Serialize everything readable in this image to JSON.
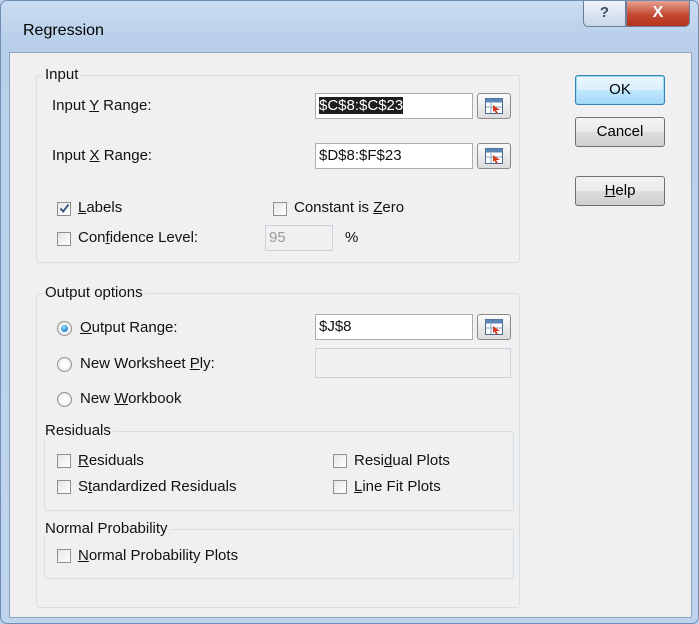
{
  "window": {
    "title": "Regression",
    "help_glyph": "?",
    "close_glyph": "X"
  },
  "input": {
    "group_title": "Input",
    "y_label_pre": "Input ",
    "y_label_u": "Y",
    "y_label_post": " Range:",
    "y_value": "$C$8:$C$23",
    "x_label_pre": "Input ",
    "x_label_u": "X",
    "x_label_post": " Range:",
    "x_value": "$D$8:$F$23",
    "labels_u": "L",
    "labels_rest": "abels",
    "labels_checked": true,
    "constant_pre": "Constant is ",
    "constant_u": "Z",
    "constant_post": "ero",
    "constant_checked": false,
    "confidence_pre": "Con",
    "confidence_u": "f",
    "confidence_post": "idence Level:",
    "confidence_checked": false,
    "confidence_value": "95",
    "percent": "%"
  },
  "output": {
    "group_title": "Output options",
    "output_range_u": "O",
    "output_range_rest": "utput Range:",
    "output_range_selected": true,
    "output_range_value": "$J$8",
    "new_ply_pre": "New Worksheet ",
    "new_ply_u": "P",
    "new_ply_post": "ly:",
    "new_ply_value": "",
    "new_workbook_pre": "New ",
    "new_workbook_u": "W",
    "new_workbook_post": "orkbook"
  },
  "residuals": {
    "group_title": "Residuals",
    "residuals_u": "R",
    "residuals_rest": "esiduals",
    "standardized_pre": "S",
    "standardized_u": "t",
    "standardized_post": "andardized Residuals",
    "residual_plots_pre": "Resi",
    "residual_plots_u": "d",
    "residual_plots_post": "ual Plots",
    "line_fit_pre": "",
    "line_fit_u": "L",
    "line_fit_post": "ine Fit Plots"
  },
  "normal": {
    "group_title": "Normal Probability",
    "plots_u": "N",
    "plots_rest": "ormal Probability Plots"
  },
  "buttons": {
    "ok": "OK",
    "cancel": "Cancel",
    "help_u": "H",
    "help_rest": "elp"
  },
  "colors": {
    "selection": "#1e1e1e",
    "radio_dot": "#1a7fd0",
    "close_button": "#c24a32"
  }
}
